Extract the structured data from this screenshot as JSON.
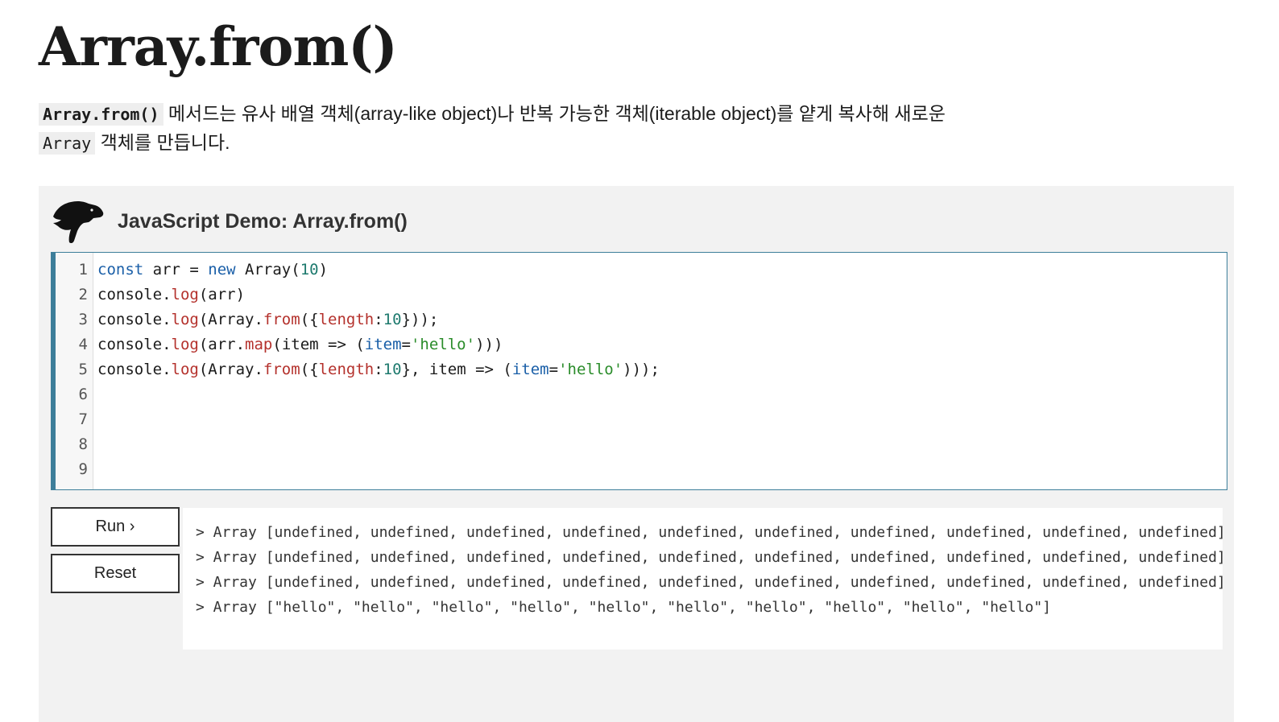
{
  "page": {
    "title": "Array.from()",
    "intro": {
      "code1": "Array.from()",
      "text1": " 메서드는 유사 배열 객체(array-like object)나 반복 가능한 객체(iterable object)를 얕게 복사해 새로운",
      "code2": "Array",
      "text2": " 객체를 만듭니다."
    }
  },
  "demo": {
    "logo_icon": "dinosaur-logo-icon",
    "title": "JavaScript Demo: Array.from()",
    "editor": {
      "line_numbers": [
        "1",
        "2",
        "3",
        "4",
        "5",
        "6",
        "7",
        "8",
        "9"
      ],
      "lines": [
        "const arr = new Array(10)",
        "console.log(arr)",
        "console.log(Array.from({length:10}));",
        "console.log(arr.map(item => (item='hello')))",
        "console.log(Array.from({length:10}, item => (item='hello')));",
        "",
        "",
        "",
        ""
      ]
    },
    "buttons": {
      "run": "Run ›",
      "reset": "Reset"
    },
    "output": [
      "> Array [undefined, undefined, undefined, undefined, undefined, undefined, undefined, undefined, undefined, undefined]",
      "> Array [undefined, undefined, undefined, undefined, undefined, undefined, undefined, undefined, undefined, undefined]",
      "> Array [undefined, undefined, undefined, undefined, undefined, undefined, undefined, undefined, undefined, undefined]",
      "> Array [\"hello\", \"hello\", \"hello\", \"hello\", \"hello\", \"hello\", \"hello\", \"hello\", \"hello\", \"hello\"]"
    ],
    "colors": {
      "editor_accent": "#3d7e9a",
      "keyword": "#1a5fa8",
      "method": "#b4312c",
      "number": "#1e7a6e",
      "string": "#2a8c2a",
      "panel_bg": "#f2f2f2"
    }
  }
}
